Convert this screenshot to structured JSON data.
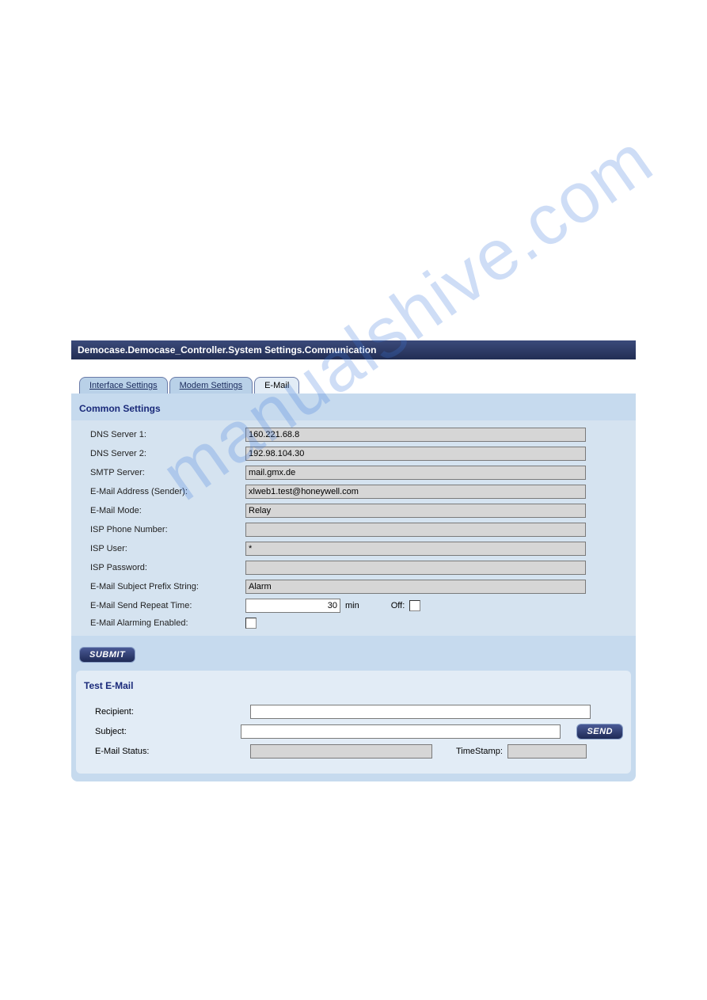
{
  "watermark": "manualshive.com",
  "titleBar": "Democase.Democase_Controller.System Settings.Communication",
  "tabs": {
    "interface": "Interface Settings",
    "modem": "Modem Settings",
    "email": "E-Mail"
  },
  "common": {
    "header": "Common Settings",
    "dns1": {
      "label": "DNS Server 1:",
      "value": "160.221.68.8"
    },
    "dns2": {
      "label": "DNS Server 2:",
      "value": "192.98.104.30"
    },
    "smtp": {
      "label": "SMTP Server:",
      "value": "mail.gmx.de"
    },
    "sender": {
      "label": "E-Mail Address (Sender):",
      "value": "xlweb1.test@honeywell.com"
    },
    "mode": {
      "label": "E-Mail Mode:",
      "value": "Relay"
    },
    "ispPhone": {
      "label": "ISP Phone Number:",
      "value": ""
    },
    "ispUser": {
      "label": "ISP User:",
      "value": "*"
    },
    "ispPassword": {
      "label": "ISP Password:",
      "value": ""
    },
    "subjectPrefix": {
      "label": "E-Mail Subject Prefix String:",
      "value": "Alarm"
    },
    "repeatTime": {
      "label": "E-Mail Send Repeat Time:",
      "value": "30",
      "unit": "min",
      "offLabel": "Off:"
    },
    "alarmingEnabled": {
      "label": "E-Mail Alarming Enabled:"
    }
  },
  "submitLabel": "SUBMIT",
  "test": {
    "header": "Test E-Mail",
    "recipient": {
      "label": "Recipient:",
      "value": ""
    },
    "subject": {
      "label": "Subject:",
      "value": ""
    },
    "status": {
      "label": "E-Mail Status:",
      "value": "",
      "tsLabel": "TimeStamp:",
      "tsValue": ""
    },
    "sendLabel": "SEND"
  }
}
